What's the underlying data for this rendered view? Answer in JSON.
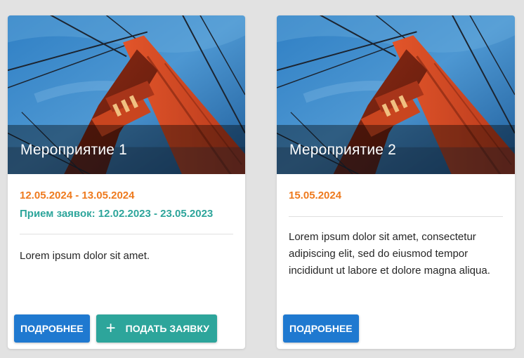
{
  "colors": {
    "page_bg": "#e2e2e2",
    "date_orange": "#ee7a1e",
    "apply_teal": "#2da59b",
    "primary_blue": "#1f79d0"
  },
  "events": [
    {
      "title": "Мероприятие 1",
      "image": "bridge-tower-photo",
      "date": "12.05.2024 - 13.05.2024",
      "apply_period": "Прием заявок: 12.02.2023 - 23.05.2023",
      "description": "Lorem ipsum dolor sit amet.",
      "details_label": "ПОДРОБНЕЕ",
      "apply_label": "ПОДАТЬ ЗАЯВКУ",
      "apply_icon": "plus-icon"
    },
    {
      "title": "Мероприятие 2",
      "image": "bridge-tower-photo",
      "date": "15.05.2024",
      "description": "Lorem ipsum dolor sit amet, consectetur adipiscing elit, sed do eiusmod tempor incididunt ut labore et dolore magna aliqua.",
      "details_label": "ПОДРОБНЕЕ"
    }
  ]
}
